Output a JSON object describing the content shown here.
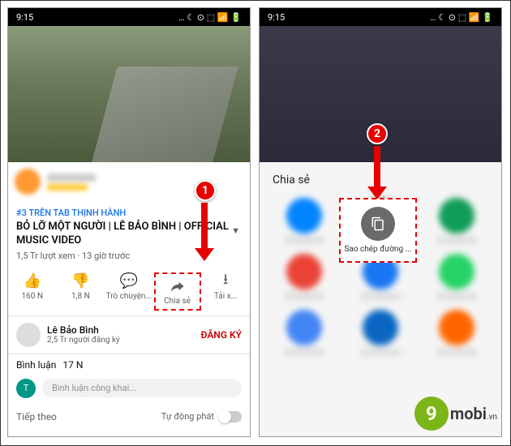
{
  "status": {
    "time": "9:15",
    "icons": "… ☾ ⊙ ⬚ 📶 🔋"
  },
  "left": {
    "trending": "#3 TRÊN TAB THỊNH HÀNH",
    "title": "BỎ LỠ MỘT NGƯỜI | LÊ BẢO BÌNH | OFFICIAL MUSIC VIDEO",
    "views": "1,5 Tr lượt xem",
    "age": "13 giờ trước",
    "actions": {
      "like": "160 N",
      "dislike": "1,8 N",
      "chat": "Trò chuyện...",
      "share": "Chia sẻ",
      "download": "Tải x..."
    },
    "channel": {
      "name": "Lê Bảo Bình",
      "subs": "2,5 Tr người đăng ký",
      "subscribe": "ĐĂNG KÝ"
    },
    "comments_label": "Bình luận",
    "comments_count": "17 N",
    "comment_placeholder": "Bình luận công khai...",
    "upnext": "Tiếp theo",
    "autoplay": "Tự động phát"
  },
  "right": {
    "share_title": "Chia sẻ",
    "copy_label": "Sao chép đường ..."
  },
  "markers": {
    "m1": "1",
    "m2": "2"
  },
  "watermark": {
    "number": "9",
    "text": "mobi",
    "vn": ".vn"
  }
}
